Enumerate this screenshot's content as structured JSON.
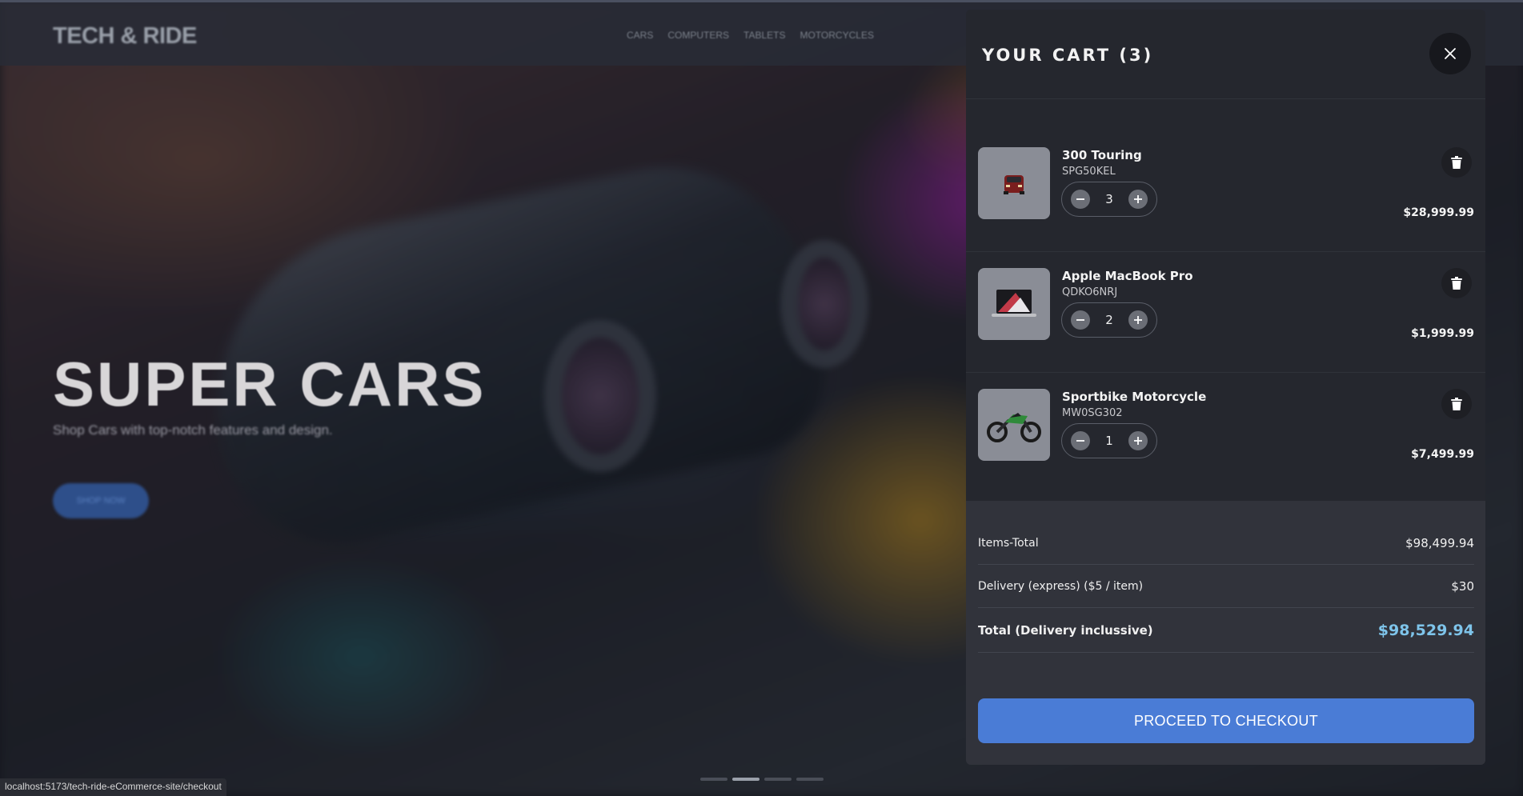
{
  "site": {
    "brand": "TECH & RIDE",
    "nav": [
      "CARS",
      "COMPUTERS",
      "TABLETS",
      "MOTORCYCLES"
    ]
  },
  "hero": {
    "title": "SUPER CARS",
    "subtitle": "Shop Cars with top-notch features and design.",
    "cta": "SHOP NOW"
  },
  "status_bar": {
    "url": "localhost:5173/tech-ride-eCommerce-site/checkout"
  },
  "cart": {
    "title": "YOUR CART (3)",
    "items": [
      {
        "name": "300 Touring",
        "sku": "SPG50KEL",
        "qty": "3",
        "price": "$28,999.99",
        "image": "car-thumbnail"
      },
      {
        "name": "Apple MacBook Pro",
        "sku": "QDKO6NRJ",
        "qty": "2",
        "price": "$1,999.99",
        "image": "laptop-thumbnail"
      },
      {
        "name": "Sportbike Motorcycle",
        "sku": "MW0SG302",
        "qty": "1",
        "price": "$7,499.99",
        "image": "motorcycle-thumbnail"
      }
    ],
    "summary": {
      "items_total_label": "Items-Total",
      "items_total": "$98,499.94",
      "delivery_label": "Delivery (express) ($5 / item)",
      "delivery": "$30",
      "total_label": "Total (Delivery inclussive)",
      "total": "$98,529.94"
    },
    "checkout_label": "PROCEED TO CHECKOUT"
  },
  "colors": {
    "accent": "#4a7cd6",
    "total_highlight": "#7ec4ea",
    "drawer_bg": "#25272e"
  }
}
